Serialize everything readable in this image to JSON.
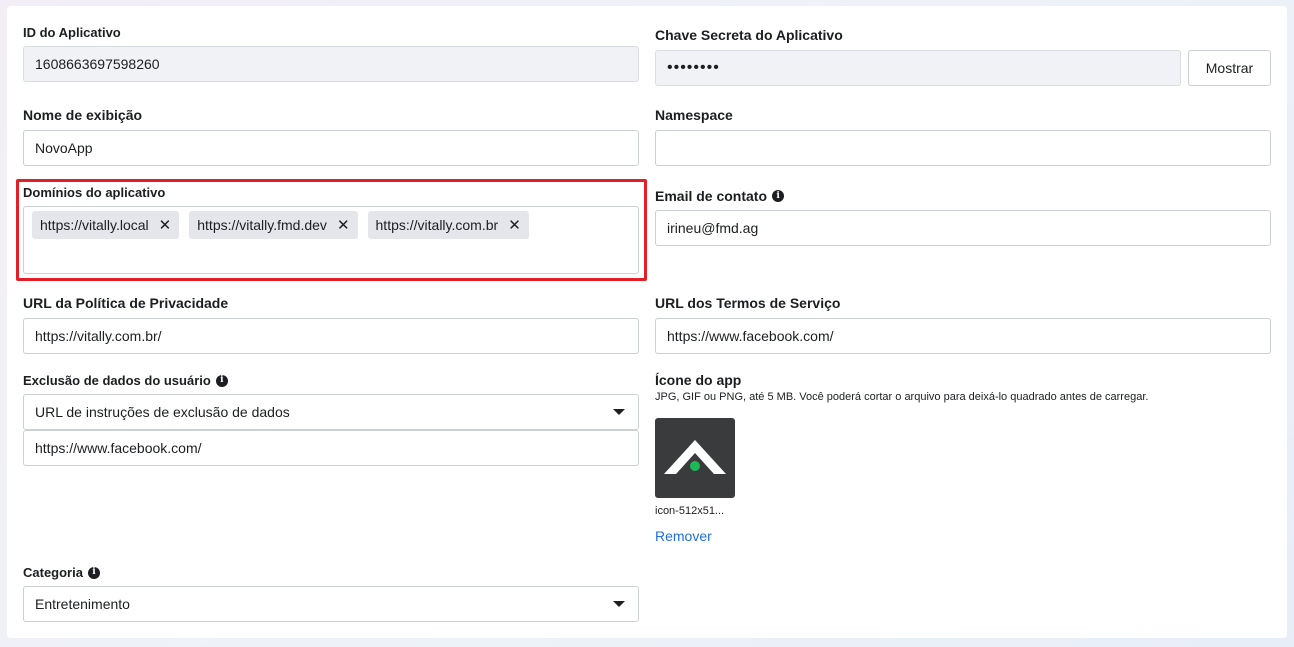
{
  "app_id": {
    "label": "ID do Aplicativo",
    "value": "1608663697598260"
  },
  "app_secret": {
    "label": "Chave Secreta do Aplicativo",
    "value": "••••••••",
    "show_button": "Mostrar"
  },
  "display_name": {
    "label": "Nome de exibição",
    "value": "NovoApp"
  },
  "namespace": {
    "label": "Namespace",
    "value": ""
  },
  "app_domains": {
    "label": "Domínios do aplicativo",
    "tags": [
      "https://vitally.local",
      "https://vitally.fmd.dev",
      "https://vitally.com.br"
    ],
    "remove_glyph": "✕",
    "highlight_color": "#e41e26"
  },
  "contact_email": {
    "label": "Email de contato",
    "value": "irineu@fmd.ag"
  },
  "privacy_url": {
    "label": "URL da Política de Privacidade",
    "value": "https://vitally.com.br/"
  },
  "tos_url": {
    "label": "URL dos Termos de Serviço",
    "value": "https://www.facebook.com/"
  },
  "data_deletion": {
    "label": "Exclusão de dados do usuário",
    "selected": "URL de instruções de exclusão de dados",
    "value": "https://www.facebook.com/"
  },
  "app_icon": {
    "label": "Ícone do app",
    "hint": "JPG, GIF ou PNG, até 5 MB. Você poderá cortar o arquivo para deixá-lo quadrado antes de carregar.",
    "filename": "icon-512x51...",
    "remove": "Remover",
    "bg_color": "#3a3b3c",
    "dot_color": "#1db954"
  },
  "category": {
    "label": "Categoria",
    "selected": "Entretenimento"
  },
  "colors": {
    "link": "#216fdb",
    "border": "#ccd0d5",
    "readonly_bg": "#f0f2f5"
  }
}
